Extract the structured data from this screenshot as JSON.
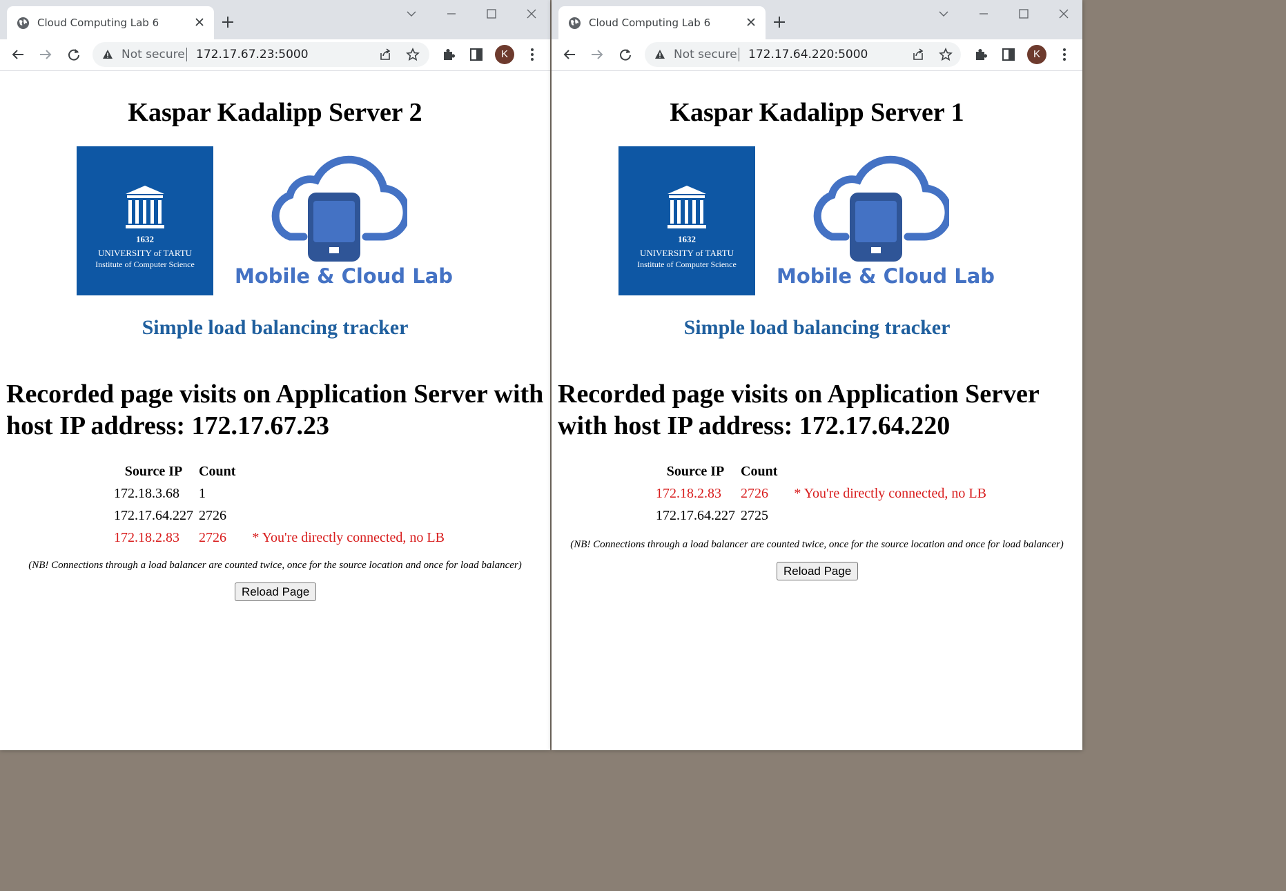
{
  "browser": {
    "not_secure_label": "Not secure"
  },
  "left_window": {
    "tab_title": "Cloud Computing Lab 6",
    "url": "172.17.67.23:5000",
    "avatar_letter": "K",
    "page": {
      "heading": "Kaspar Kadalipp Server 2",
      "subtitle": "Simple load balancing tracker",
      "visits_title": "Recorded page visits on Application Server with host IP address: 172.17.67.23",
      "table_headers": [
        "Source IP",
        "Count"
      ],
      "rows": [
        {
          "ip": "172.18.3.68",
          "count": "1",
          "note": "",
          "direct": false
        },
        {
          "ip": "172.17.64.227",
          "count": "2726",
          "note": "",
          "direct": false
        },
        {
          "ip": "172.18.2.83",
          "count": "2726",
          "note": "* You're directly connected, no LB",
          "direct": true
        }
      ],
      "nb_note": "(NB! Connections through a load balancer are counted twice, once for the source location and once for load balancer)",
      "reload_label": "Reload Page"
    }
  },
  "right_window": {
    "tab_title": "Cloud Computing Lab 6",
    "url": "172.17.64.220:5000",
    "avatar_letter": "K",
    "page": {
      "heading": "Kaspar Kadalipp Server 1",
      "subtitle": "Simple load balancing tracker",
      "visits_title": "Recorded page visits on Application Server with host IP address: 172.17.64.220",
      "table_headers": [
        "Source IP",
        "Count"
      ],
      "rows": [
        {
          "ip": "172.18.2.83",
          "count": "2726",
          "note": "* You're directly connected, no LB",
          "direct": true
        },
        {
          "ip": "172.17.64.227",
          "count": "2725",
          "note": "",
          "direct": false
        }
      ],
      "nb_note": "(NB! Connections through a load balancer are counted twice, once for the source location and once for load balancer)",
      "reload_label": "Reload Page"
    }
  },
  "logos": {
    "ut_year": "1632",
    "ut_name": "UNIVERSITY of TARTU",
    "ut_institute": "Institute of Computer Science",
    "mcl_text": "Mobile & Cloud Lab"
  },
  "colors": {
    "ut_blue": "#0e57a4",
    "mcl_blue": "#4472c4",
    "subtitle_blue": "#1f5f9e",
    "direct_red": "#d81c1c"
  }
}
